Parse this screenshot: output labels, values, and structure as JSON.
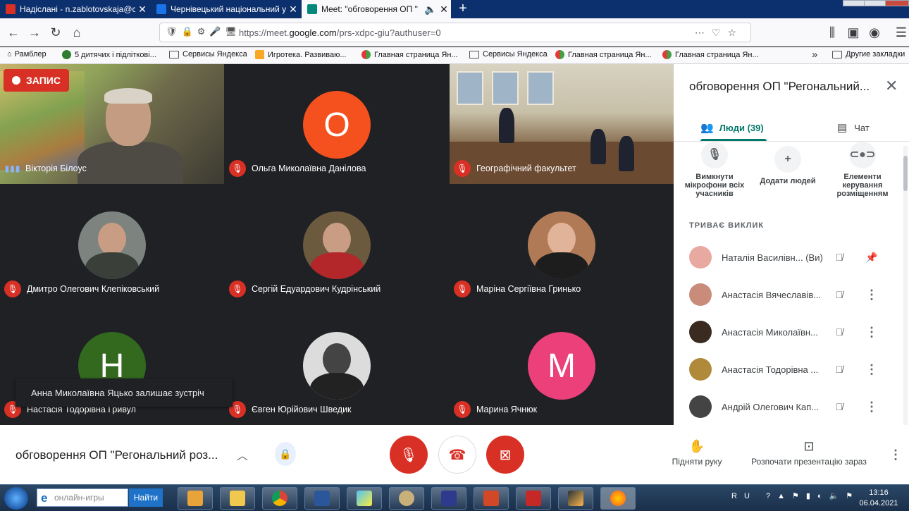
{
  "browser": {
    "tabs": [
      {
        "title": "Надіслані - n.zablotovskaja@c",
        "favicon_color": "#d93025"
      },
      {
        "title": "Чернівецький національний у",
        "favicon_color": "#1a73e8"
      },
      {
        "title": "Meet: \"обговорення ОП \"",
        "favicon_color": "#00897b"
      }
    ],
    "url_prefix": "https://meet.",
    "url_domain": "google.com",
    "url_path": "/prs-xdpc-giu?authuser=0"
  },
  "bookmarks": [
    {
      "label": "Рамблер",
      "icon": "home-icon"
    },
    {
      "label": "5 дитячих і підліткові...",
      "icon": "site-icon"
    },
    {
      "label": "Сервисы Яндекса",
      "icon": "folder-icon"
    },
    {
      "label": "Игротека. Развиваю...",
      "icon": "site-icon"
    },
    {
      "label": "Главная страница Ян...",
      "icon": "yandex-icon"
    },
    {
      "label": "Сервисы Яндекса",
      "icon": "folder-icon"
    },
    {
      "label": "Главная страница Ян...",
      "icon": "yandex-icon"
    },
    {
      "label": "Главная страница Ян...",
      "icon": "yandex-icon"
    },
    {
      "label": "Другие закладки",
      "icon": "folder-icon"
    }
  ],
  "meeting": {
    "recording_label": "ЗАПИС",
    "toast": "Анна Миколаївна Яцько залишає зустріч",
    "tiles": [
      {
        "name": "Вікторія Білоус",
        "kind": "video",
        "mic": "speaking"
      },
      {
        "name": "Ольга Миколаївна Данілова",
        "kind": "letter",
        "letter": "О",
        "color": "#f4511e",
        "mic": "off"
      },
      {
        "name": "Географічний факультет",
        "kind": "video",
        "mic": "off"
      },
      {
        "name": "Дмитро Олегович Клепіковський",
        "kind": "photo",
        "color": "#3a3f3a",
        "mic": "off"
      },
      {
        "name": "Сергій Едуардович Кудрінський",
        "kind": "photo",
        "color": "#b3262a",
        "mic": "off"
      },
      {
        "name": "Маріна Сергіївна Гринько",
        "kind": "photo",
        "color": "#1d1d1d",
        "mic": "off"
      },
      {
        "name": "Настасія Тодорівна Гривул",
        "kind": "letter",
        "letter": "Н",
        "color": "#33691e",
        "mic": "off"
      },
      {
        "name": "Євген Юрійович Шведик",
        "kind": "photo",
        "color": "#222222",
        "mic": "off"
      },
      {
        "name": "Марина Ячнюк",
        "kind": "letter",
        "letter": "М",
        "color": "#ec407a",
        "mic": "off"
      }
    ]
  },
  "panel": {
    "title": "обговорення ОП \"Регональний...",
    "tab_people": "Люди (39)",
    "tab_chat": "Чат",
    "actions": [
      {
        "label": "Вимкнути мікрофони всіх учасників",
        "icon": "mic-off-icon"
      },
      {
        "label": "Додати людей",
        "icon": "add-person-icon"
      },
      {
        "label": "Елементи керування розміщенням",
        "icon": "toggle-icon"
      }
    ],
    "section": "ТРИВАЄ ВИКЛИК",
    "people": [
      {
        "name": "Наталія Василівн...",
        "suffix": "(Ви)",
        "avatar_color": "#e8a9a0",
        "trailing": "pin-icon"
      },
      {
        "name": "Анастасія Вячеславів...",
        "suffix": "",
        "avatar_color": "#c98c7a",
        "trailing": "more-icon"
      },
      {
        "name": "Анастасія Миколаївн...",
        "suffix": "",
        "avatar_color": "#3b2a20",
        "trailing": "more-icon"
      },
      {
        "name": "Анастасія Тодорівна ...",
        "suffix": "",
        "avatar_color": "#b08a3a",
        "trailing": "more-icon"
      },
      {
        "name": "Андрій Олегович Кап...",
        "suffix": "",
        "avatar_color": "#444444",
        "trailing": "more-icon"
      }
    ]
  },
  "bottom": {
    "meeting_title": "обговорення ОП \"Регональний роз...",
    "raise_hand": "Підняти руку",
    "present": "Розпочати презентацію зараз"
  },
  "taskbar": {
    "search_placeholder": "онлайн-игры",
    "find_label": "Найти",
    "lang": "RU",
    "time": "13:16",
    "date": "06.04.2021"
  }
}
